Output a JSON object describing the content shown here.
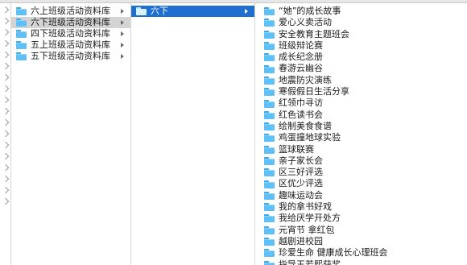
{
  "col1": {
    "items": [
      {
        "label": "六上班级活动资料库",
        "state": "normal"
      },
      {
        "label": "六下班级活动资料库",
        "state": "selected"
      },
      {
        "label": "四下班级活动资料库",
        "state": "normal"
      },
      {
        "label": "五上班级活动资料库",
        "state": "normal"
      },
      {
        "label": "五下班级活动资料库",
        "state": "normal"
      }
    ]
  },
  "col2": {
    "items": [
      {
        "label": "六下",
        "state": "active"
      }
    ]
  },
  "col3": {
    "items": [
      {
        "label": "“她”的成长故事"
      },
      {
        "label": "爱心义卖活动"
      },
      {
        "label": "安全教育主题班会"
      },
      {
        "label": "班级辩论赛"
      },
      {
        "label": "成长纪念册"
      },
      {
        "label": "春游云幽谷"
      },
      {
        "label": "地震防灾演练"
      },
      {
        "label": "寒假假日生活分享"
      },
      {
        "label": "红领巾寻访"
      },
      {
        "label": "红色读书会"
      },
      {
        "label": "绘制美食食谱"
      },
      {
        "label": "鸡蛋撞地球实验"
      },
      {
        "label": "篮球联赛"
      },
      {
        "label": "亲子家长会"
      },
      {
        "label": "区三好评选"
      },
      {
        "label": "区优少评选"
      },
      {
        "label": "趣味运动会"
      },
      {
        "label": "我的拿书好戏"
      },
      {
        "label": "我给厌学开处方"
      },
      {
        "label": "元宵节 拿红包"
      },
      {
        "label": "越剧进校园"
      },
      {
        "label": "珍爱生命 健康成长心理班会"
      },
      {
        "label": "指导王若熙获奖"
      }
    ]
  },
  "colors": {
    "folder": "#5ec0f6",
    "selection_active": "#1f6fd1",
    "selection_inactive": "#d4d4d4"
  }
}
